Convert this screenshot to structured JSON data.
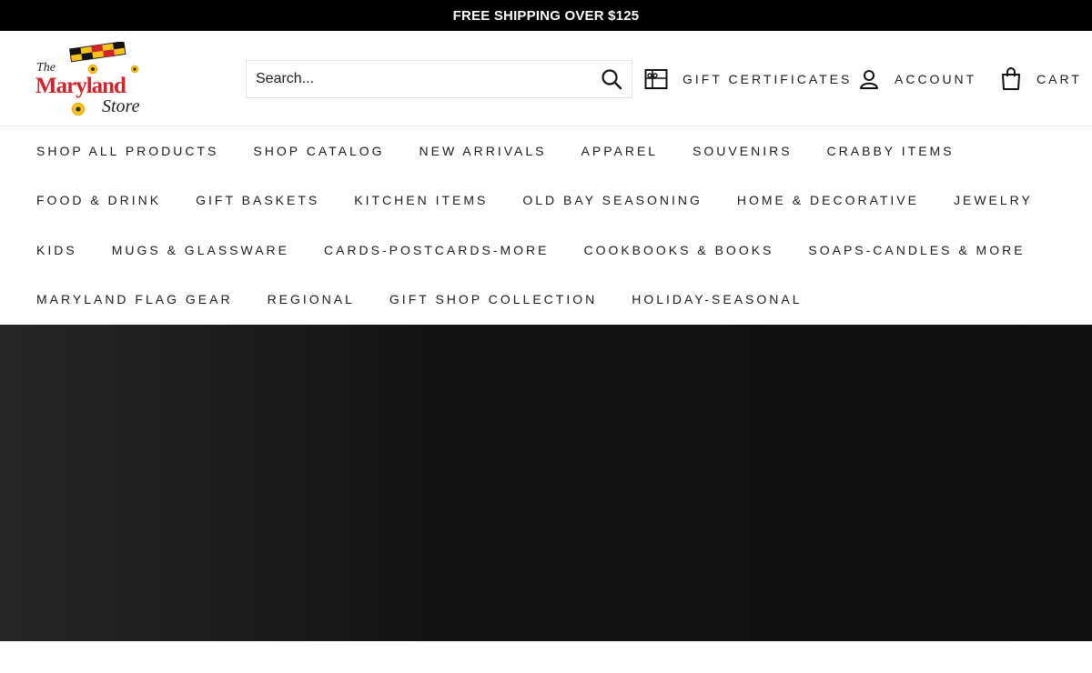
{
  "announcement": "FREE SHIPPING OVER $125",
  "logo": {
    "line1": "The",
    "line2": "Maryland",
    "line3": "Store"
  },
  "search": {
    "placeholder": "Search..."
  },
  "header_links": {
    "gift": "GIFT CERTIFICATES",
    "account": "ACCOUNT",
    "cart": "CART"
  },
  "nav": {
    "rows": [
      [
        "SHOP ALL PRODUCTS",
        "SHOP CATALOG",
        "NEW ARRIVALS",
        "APPAREL",
        "SOUVENIRS",
        "CRABBY ITEMS"
      ],
      [
        "FOOD & DRINK",
        "GIFT BASKETS",
        "KITCHEN ITEMS",
        "OLD BAY SEASONING",
        "HOME & DECORATIVE",
        "JEWELRY"
      ],
      [
        "KIDS",
        "MUGS & GLASSWARE",
        "CARDS-POSTCARDS-MORE",
        "COOKBOOKS & BOOKS",
        "SOAPS-CANDLES & MORE"
      ],
      [
        "MARYLAND FLAG GEAR",
        "REGIONAL",
        "GIFT SHOP COLLECTION",
        "HOLIDAY-SEASONAL"
      ]
    ]
  },
  "colors": {
    "announcement_bg": "#000000",
    "logo_red": "#d3232a",
    "flag_yellow": "#f4c21a",
    "hero_dark": "#111111"
  }
}
